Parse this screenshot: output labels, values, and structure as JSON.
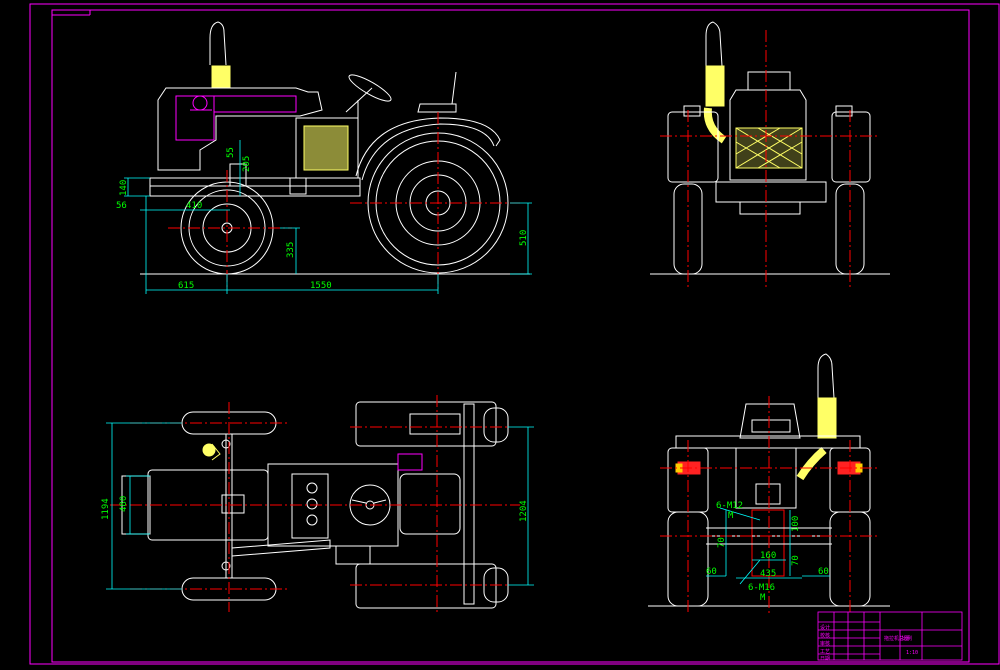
{
  "colors": {
    "frame": "#ff00ff",
    "outline": "#ffffff",
    "center": "#ff0000",
    "dimension": "#00ffff",
    "dim_text": "#00ff00",
    "muffler": "#ffff66",
    "accent": "#ff00ff",
    "lamp": "#ff2222",
    "lamp_amber": "#ffcc00",
    "radiator": "#ffff66"
  },
  "dimensions": {
    "side": {
      "d140": "140",
      "d56": "56",
      "d410": "410",
      "d55": "55",
      "d205": "205",
      "d335": "335",
      "d510": "510",
      "d615": "615",
      "d1550": "1550"
    },
    "top": {
      "d1194": "1194",
      "d480": "480",
      "d1204": "1204"
    },
    "rear": {
      "bolt_top": "6-M12",
      "bolt_top_mark": "M",
      "bolt_bottom": "6-M16",
      "bolt_bottom_mark": "M",
      "d70a": "70",
      "d70b": "70",
      "d100": "100",
      "d160": "160",
      "d435": "435",
      "d60a": "60",
      "d60b": "60"
    }
  },
  "title_block": {
    "rows": [
      "设计",
      "校核",
      "审核",
      "工艺",
      "日期"
    ],
    "name": "拖拉机总图",
    "scale": "比例",
    "sheet": "1:10"
  }
}
